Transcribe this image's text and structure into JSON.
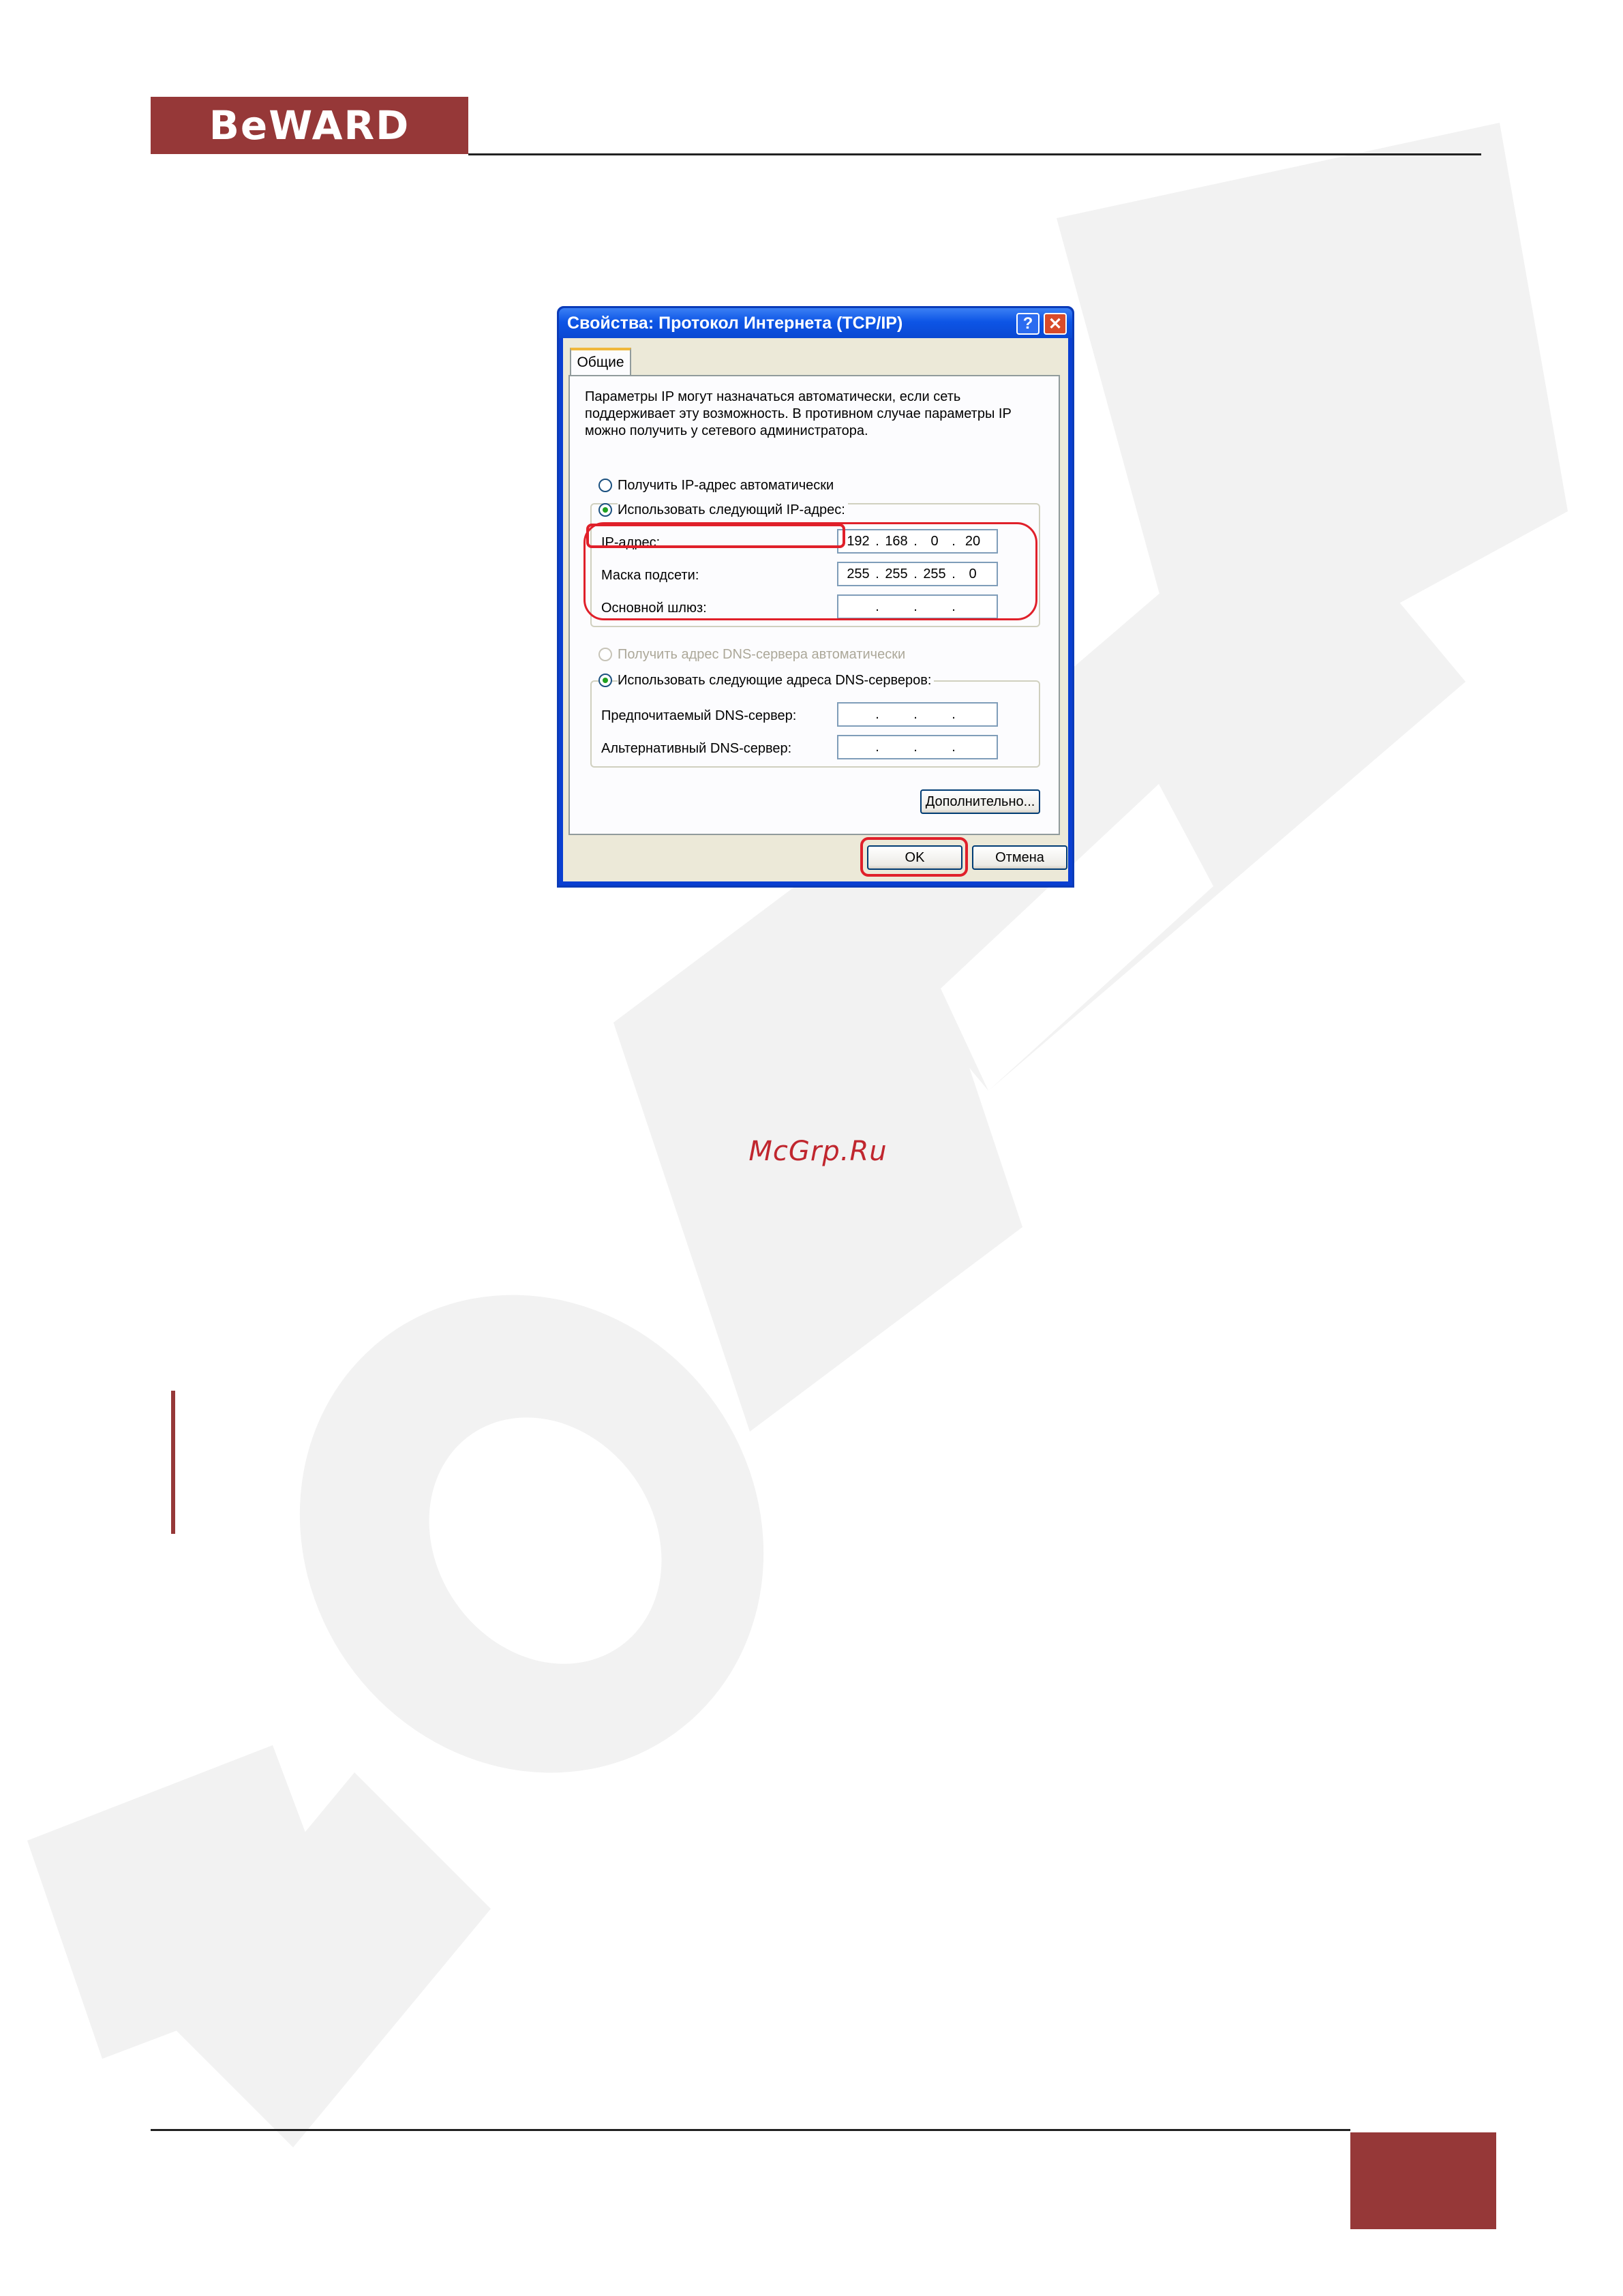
{
  "header": {
    "logo": "BeWARD"
  },
  "dialog": {
    "title": "Свойства: Протокол Интернета (TCP/IP)",
    "help_glyph": "?",
    "close_glyph": "✕",
    "tab_label": "Общие",
    "intro_text": "Параметры IP могут назначаться автоматически, если сеть поддерживает эту возможность. В противном случае параметры IP можно получить у сетевого администратора.",
    "radio_auto_ip": "Получить IP-адрес автоматически",
    "radio_manual_ip": "Использовать следующий IP-адрес:",
    "ip_label": "IP-адрес:",
    "ip_value": [
      "192",
      "168",
      "0",
      "20"
    ],
    "mask_label": "Маска подсети:",
    "mask_value": [
      "255",
      "255",
      "255",
      "0"
    ],
    "gateway_label": "Основной шлюз:",
    "gateway_value": [
      "",
      "",
      "",
      ""
    ],
    "radio_auto_dns": "Получить адрес DNS-сервера автоматически",
    "radio_manual_dns": "Использовать следующие адреса DNS-серверов:",
    "dns_preferred_label": "Предпочитаемый DNS-сервер:",
    "dns_alternate_label": "Альтернативный DNS-сервер:",
    "advanced_button": "Дополнительно...",
    "ok_button": "OK",
    "cancel_button": "Отмена",
    "dot": "."
  },
  "page": {
    "watermark_link": "McGrp.Ru"
  },
  "colors": {
    "brand": "#963838",
    "highlight": "#e0202a",
    "xp_blue": "#0a48d2"
  }
}
